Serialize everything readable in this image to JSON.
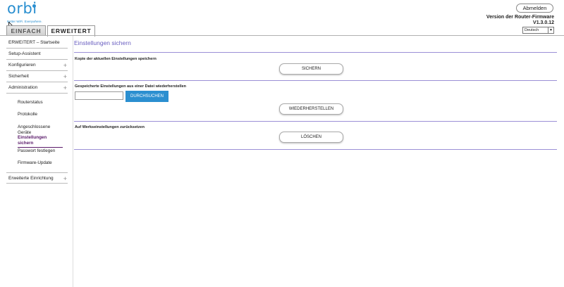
{
  "brand": {
    "logo_text": "orbi",
    "tagline": "Better WiFi. Everywhere."
  },
  "tabs": [
    {
      "label": "EINFACH"
    },
    {
      "label": "ERWEITERT"
    }
  ],
  "header": {
    "logout_label": "Abmelden",
    "firmware_title": "Version der Router-Firmware",
    "firmware_version": "V1.3.0.12",
    "language_value": "Deutsch"
  },
  "sidebar": {
    "items": [
      {
        "label": "ERWEITERT – Startseite"
      },
      {
        "label": "Setup-Assistent"
      },
      {
        "label": "Konfigurieren"
      },
      {
        "label": "Sicherheit"
      },
      {
        "label": "Administration"
      },
      {
        "label": "Erweiterte Einrichtung"
      }
    ],
    "admin_sub": [
      {
        "label": "Routerstatus"
      },
      {
        "label": "Protokolle"
      },
      {
        "label": "Angeschlossene Geräte"
      },
      {
        "label": "Einstellungen sichern"
      },
      {
        "label": "Passwort festlegen"
      },
      {
        "label": "Firmware-Update"
      }
    ]
  },
  "main": {
    "title": "Einstellungen sichern",
    "sections": [
      {
        "label": "Kopie der aktuellen Einstellungen speichern",
        "button": "SICHERN"
      },
      {
        "label": "Gespeicherte Einstellungen aus einer Datei wiederherstellen",
        "browse": "DURCHSUCHEN",
        "button": "WIEDERHERSTELLEN"
      },
      {
        "label": "Auf Werkseinstellungen zurücksetzen",
        "button": "LÖSCHEN"
      }
    ]
  },
  "colors": {
    "accent": "#2b8fd0",
    "divider": "#9b8fd6",
    "title": "#6a5fc0",
    "active_sub": "#5a1a6a"
  }
}
